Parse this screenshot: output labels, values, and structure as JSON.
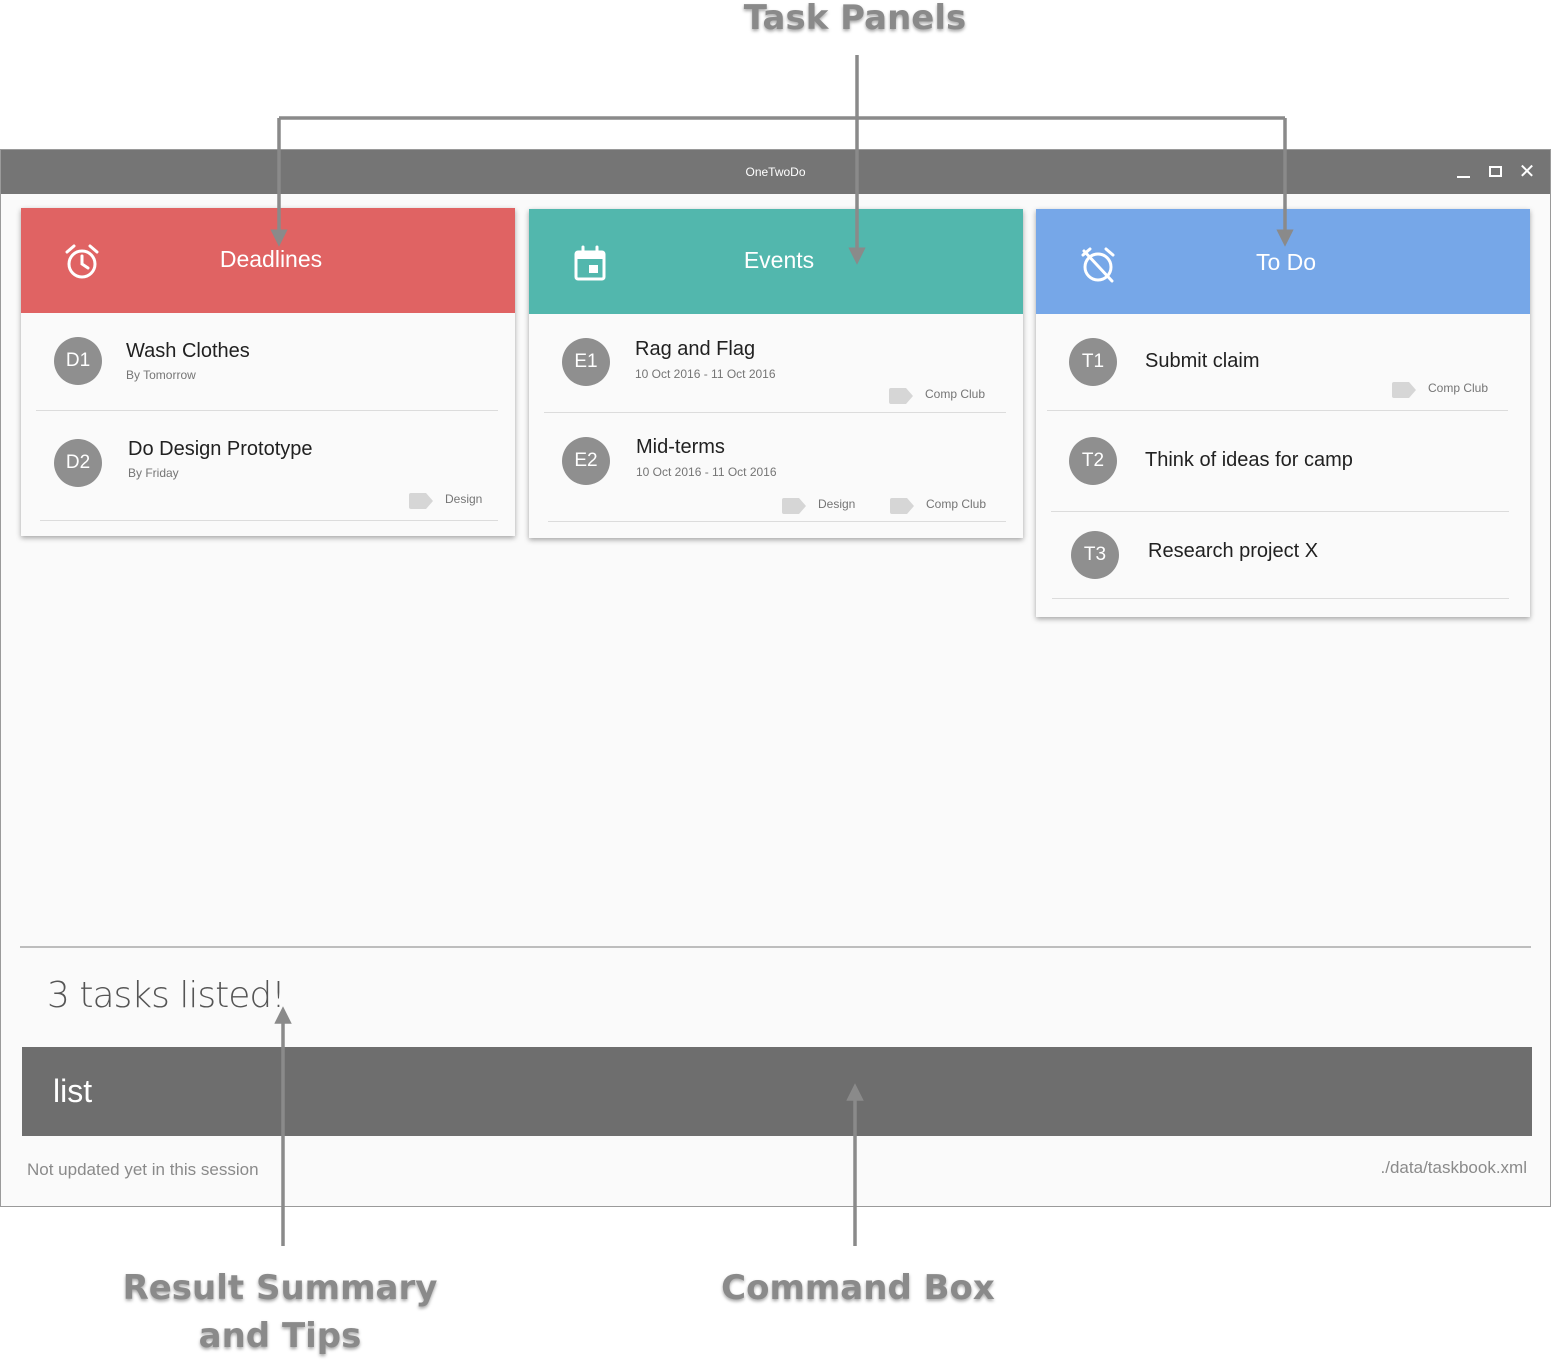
{
  "annotations": {
    "task_panels": "Task Panels",
    "result_summary_line1": "Result Summary",
    "result_summary_line2": "and Tips",
    "command_box": "Command Box"
  },
  "window": {
    "title": "OneTwoDo",
    "minimize_icon": "minimize-icon",
    "maximize_icon": "maximize-icon",
    "close_icon": "close-icon",
    "close_glyph": "✕"
  },
  "panels": {
    "deadlines": {
      "title": "Deadlines",
      "color": "#e06363",
      "icon": "alarm-clock-icon",
      "items": [
        {
          "id": "D1",
          "title": "Wash Clothes",
          "subtitle": "By Tomorrow",
          "tags": []
        },
        {
          "id": "D2",
          "title": "Do Design Prototype",
          "subtitle": "By Friday",
          "tags": [
            "Design"
          ]
        }
      ]
    },
    "events": {
      "title": "Events",
      "color": "#52b7ad",
      "icon": "calendar-icon",
      "items": [
        {
          "id": "E1",
          "title": "Rag and Flag",
          "subtitle": "10 Oct 2016 - 11 Oct 2016",
          "tags": [
            "Comp Club"
          ]
        },
        {
          "id": "E2",
          "title": "Mid-terms",
          "subtitle": "10 Oct 2016 - 11 Oct 2016",
          "tags": [
            "Design",
            "Comp Club"
          ]
        }
      ]
    },
    "todo": {
      "title": "To Do",
      "color": "#76a7e8",
      "icon": "alarm-off-icon",
      "items": [
        {
          "id": "T1",
          "title": "Submit claim",
          "tags": [
            "Comp Club"
          ]
        },
        {
          "id": "T2",
          "title": "Think of ideas for camp",
          "tags": []
        },
        {
          "id": "T3",
          "title": "Research project X",
          "tags": []
        }
      ]
    }
  },
  "result": {
    "text": "3 tasks listed!"
  },
  "command": {
    "value": "list"
  },
  "status": {
    "last_updated": "Not updated yet in this session",
    "file_path": "./data/taskbook.xml"
  },
  "colors": {
    "titlebar": "#757575",
    "command_box": "#6e6e6e",
    "avatar": "#8f8f8f",
    "annotation": "#8a8a8a"
  }
}
